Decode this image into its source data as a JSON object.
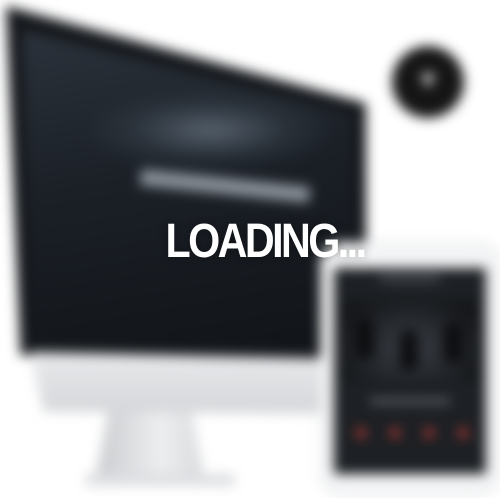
{
  "loader": {
    "text": "LOADING..."
  },
  "colors": {
    "background": "#ffffff",
    "imac_screen": "#15181c",
    "tablet_screen": "#1d2024",
    "accent_red": "#c23a36",
    "badge": "#151515",
    "loading_text": "#ffffff"
  },
  "icons": {
    "badge": "brand-logo-icon"
  }
}
